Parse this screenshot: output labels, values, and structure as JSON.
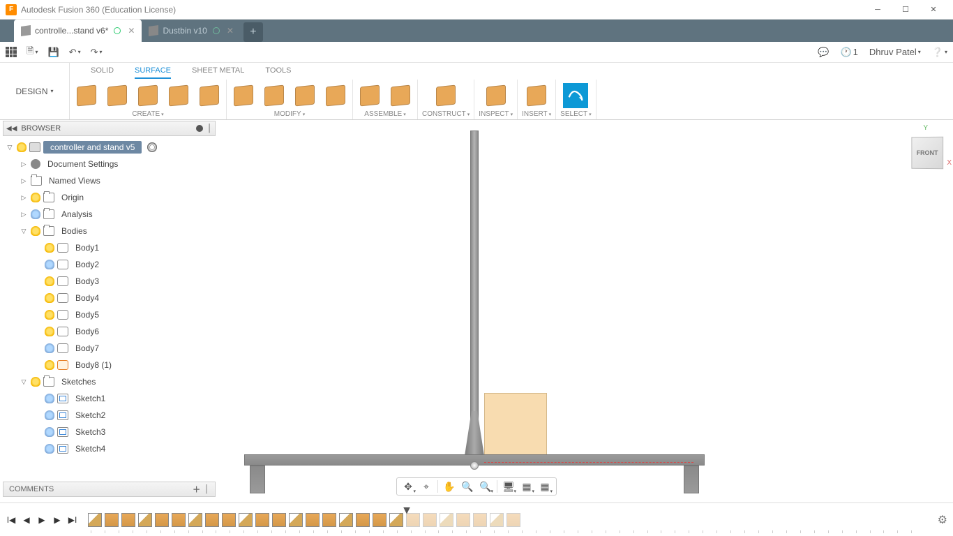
{
  "app": {
    "title": "Autodesk Fusion 360 (Education License)",
    "icon_letter": "F"
  },
  "tabs": [
    {
      "label": "controlle...stand v6*",
      "active": true
    },
    {
      "label": "Dustbin v10",
      "active": false
    }
  ],
  "quickbar": {
    "user": "Dhruv Patel",
    "clock_badge": "1"
  },
  "workspace": {
    "label": "DESIGN"
  },
  "ribbon_tabs": [
    "SOLID",
    "SURFACE",
    "SHEET METAL",
    "TOOLS"
  ],
  "ribbon_active": "SURFACE",
  "ribbon_groups": [
    {
      "label": "CREATE",
      "icons": 5
    },
    {
      "label": "MODIFY",
      "icons": 4
    },
    {
      "label": "ASSEMBLE",
      "icons": 2
    },
    {
      "label": "CONSTRUCT",
      "icons": 1
    },
    {
      "label": "INSPECT",
      "icons": 1
    },
    {
      "label": "INSERT",
      "icons": 1
    },
    {
      "label": "SELECT",
      "icons": 1
    }
  ],
  "browser": {
    "title": "BROWSER",
    "root": "controller and stand v5",
    "nodes": [
      {
        "label": "Document Settings",
        "icon": "gear",
        "indent": 1,
        "arrow": "right"
      },
      {
        "label": "Named Views",
        "icon": "folder",
        "indent": 1,
        "arrow": "right"
      },
      {
        "label": "Origin",
        "icon": "folder",
        "indent": 1,
        "arrow": "right",
        "bulb": "on"
      },
      {
        "label": "Analysis",
        "icon": "folder",
        "indent": 1,
        "arrow": "right",
        "bulb": "off"
      },
      {
        "label": "Bodies",
        "icon": "folder",
        "indent": 1,
        "arrow": "down",
        "bulb": "on"
      },
      {
        "label": "Body1",
        "icon": "body",
        "indent": 2,
        "bulb": "on"
      },
      {
        "label": "Body2",
        "icon": "body",
        "indent": 2,
        "bulb": "off"
      },
      {
        "label": "Body3",
        "icon": "body",
        "indent": 2,
        "bulb": "on"
      },
      {
        "label": "Body4",
        "icon": "body",
        "indent": 2,
        "bulb": "on"
      },
      {
        "label": "Body5",
        "icon": "body",
        "indent": 2,
        "bulb": "on"
      },
      {
        "label": "Body6",
        "icon": "body",
        "indent": 2,
        "bulb": "on"
      },
      {
        "label": "Body7",
        "icon": "body",
        "indent": 2,
        "bulb": "off"
      },
      {
        "label": "Body8 (1)",
        "icon": "body-sel",
        "indent": 2,
        "bulb": "on"
      },
      {
        "label": "Sketches",
        "icon": "folder",
        "indent": 1,
        "arrow": "down",
        "bulb": "on"
      },
      {
        "label": "Sketch1",
        "icon": "sketch",
        "indent": 2,
        "bulb": "off"
      },
      {
        "label": "Sketch2",
        "icon": "sketch",
        "indent": 2,
        "bulb": "off"
      },
      {
        "label": "Sketch3",
        "icon": "sketch",
        "indent": 2,
        "bulb": "off"
      },
      {
        "label": "Sketch4",
        "icon": "sketch",
        "indent": 2,
        "bulb": "off"
      }
    ]
  },
  "comments": {
    "label": "COMMENTS"
  },
  "viewcube": {
    "face": "FRONT",
    "axis_y": "Y",
    "axis_x": "X"
  },
  "timeline": {
    "item_count": 26,
    "gray_after": 19,
    "marker_at": 19
  }
}
